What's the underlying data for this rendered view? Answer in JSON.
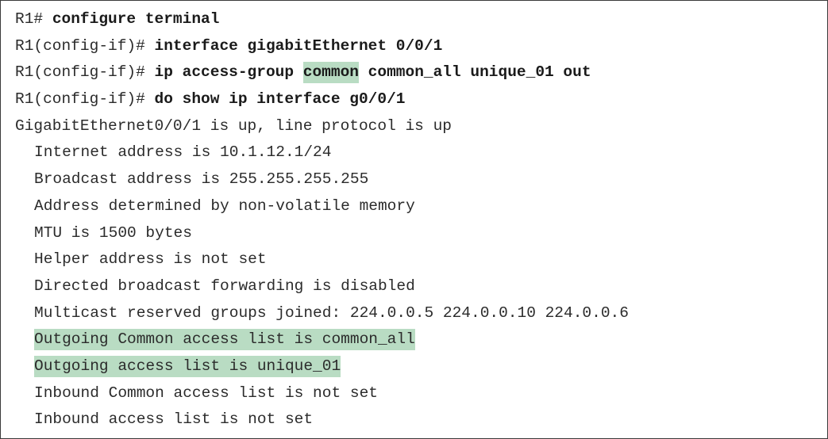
{
  "colors": {
    "highlight": "#b9dcc3",
    "text": "#2b2b2b",
    "border": "#3a3a3a"
  },
  "lines": [
    {
      "prompt": "R1# ",
      "command": "configure terminal"
    },
    {
      "prompt": "R1(config-if)# ",
      "command": "interface gigabitEthernet 0/0/1"
    },
    {
      "prompt": "R1(config-if)# ",
      "command_pre": "ip access-group ",
      "command_highlight": "common",
      "command_post": " common_all unique_01 out"
    },
    {
      "prompt": "R1(config-if)# ",
      "command": "do show ip interface g0/0/1"
    }
  ],
  "output": [
    "GigabitEthernet0/0/1 is up, line protocol is up",
    "Internet address is 10.1.12.1/24",
    "Broadcast address is 255.255.255.255",
    "Address determined by non-volatile memory",
    "MTU is 1500 bytes",
    "Helper address is not set",
    "Directed broadcast forwarding is disabled",
    "Multicast reserved groups joined: 224.0.0.5 224.0.0.10 224.0.0.6",
    "Outgoing Common access list is common_all",
    "Outgoing access list is unique_01",
    "Inbound Common access list is not set",
    "Inbound access list is not set"
  ]
}
